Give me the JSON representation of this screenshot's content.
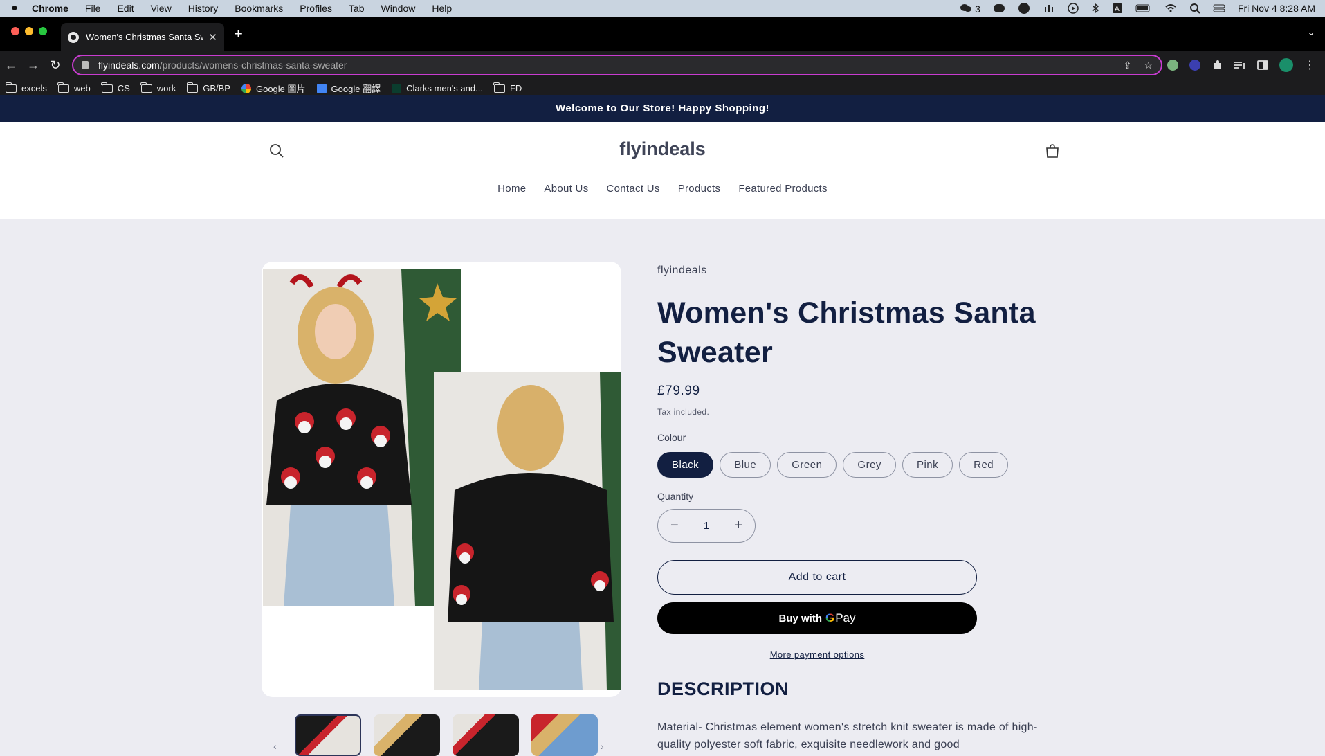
{
  "menubar": {
    "app": "Chrome",
    "items": [
      "File",
      "Edit",
      "View",
      "History",
      "Bookmarks",
      "Profiles",
      "Tab",
      "Window",
      "Help"
    ],
    "notification_count": "3",
    "datetime": "Fri Nov 4  8:28 AM"
  },
  "browser": {
    "tab_title": "Women's Christmas Santa Swe",
    "url_host": "flyindeals.com",
    "url_path": "/products/womens-christmas-santa-sweater",
    "bookmarks": [
      {
        "label": "excels",
        "icon": "folder-icon"
      },
      {
        "label": "web",
        "icon": "folder-icon"
      },
      {
        "label": "CS",
        "icon": "folder-icon"
      },
      {
        "label": "work",
        "icon": "folder-icon"
      },
      {
        "label": "GB/BP",
        "icon": "folder-icon"
      },
      {
        "label": "Google 圖片",
        "icon": "google-icon"
      },
      {
        "label": "Google 翻譯",
        "icon": "translate-icon"
      },
      {
        "label": "Clarks men's and...",
        "icon": "clarks-icon"
      },
      {
        "label": "FD",
        "icon": "folder-icon"
      }
    ]
  },
  "store": {
    "announcement": "Welcome to Our Store! Happy Shopping!",
    "logo": "flyindeals",
    "nav": [
      "Home",
      "About Us",
      "Contact Us",
      "Products",
      "Featured Products"
    ]
  },
  "product": {
    "vendor": "flyindeals",
    "title": "Women's Christmas Santa Sweater",
    "price": "£79.99",
    "tax_note": "Tax included.",
    "colour_label": "Colour",
    "colours": [
      "Black",
      "Blue",
      "Green",
      "Grey",
      "Pink",
      "Red"
    ],
    "selected_colour": "Black",
    "quantity_label": "Quantity",
    "quantity": "1",
    "add_to_cart": "Add to cart",
    "buy_with": "Buy with",
    "gpay_g": "G",
    "gpay_pay": "Pay",
    "more_payment": "More payment options",
    "description_title": "DESCRIPTION",
    "description_text": "Material- Christmas element women's stretch knit sweater is made of high-quality polyester soft fabric, exquisite needlework and good"
  },
  "colors": {
    "navy": "#121f41",
    "omnibox_border": "#c93cd1",
    "menubar_bg": "#c9d4e0"
  }
}
